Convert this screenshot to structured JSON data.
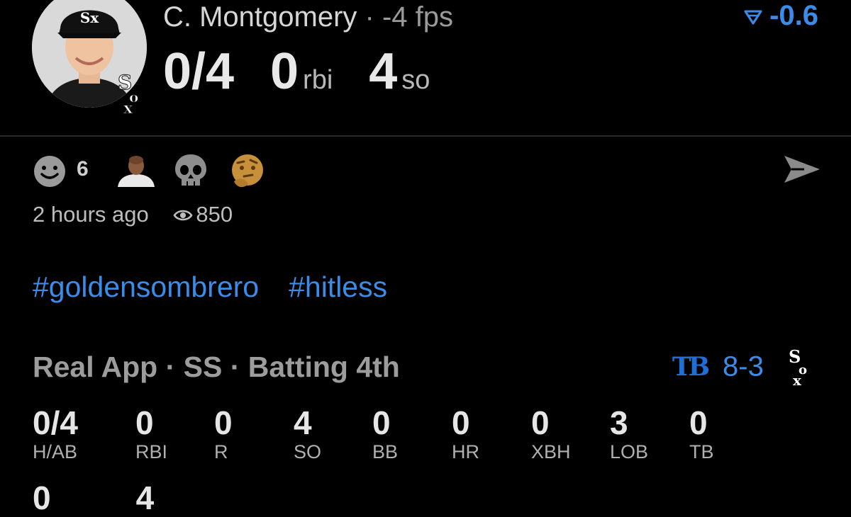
{
  "player": {
    "name": "C. Montgomery",
    "fps_text": " · -4 fps",
    "delta": "-0.6"
  },
  "summary": {
    "hab": "0/4",
    "rbi_value": "0",
    "rbi_unit": "rbi",
    "so_value": "4",
    "so_unit": "so"
  },
  "reactions": {
    "smile_count": "6",
    "icons": [
      "smile-face-icon",
      "person-emoji-icon",
      "skull-emoji-icon",
      "thinking-face-icon",
      "send-icon"
    ]
  },
  "meta": {
    "time": "2 hours ago",
    "views": "850"
  },
  "tags": [
    "#goldensombrero",
    "#hitless"
  ],
  "context": {
    "text": "Real App · SS · Batting 4th",
    "opponent_abbr": "TB",
    "score_a": "8",
    "score_sep": "-",
    "score_b": "3"
  },
  "stats": [
    {
      "value": "0/4",
      "label": "H/AB"
    },
    {
      "value": "0",
      "label": "RBI"
    },
    {
      "value": "0",
      "label": "R"
    },
    {
      "value": "4",
      "label": "SO"
    },
    {
      "value": "0",
      "label": "BB"
    },
    {
      "value": "0",
      "label": "HR"
    },
    {
      "value": "0",
      "label": "XBH"
    },
    {
      "value": "3",
      "label": "LOB"
    },
    {
      "value": "0",
      "label": "TB"
    }
  ],
  "next_row": [
    "0",
    "4"
  ],
  "colors": {
    "accent": "#3b8be8",
    "background": "#000000",
    "text": "#e6e6e6",
    "muted": "#9c9c9c"
  }
}
